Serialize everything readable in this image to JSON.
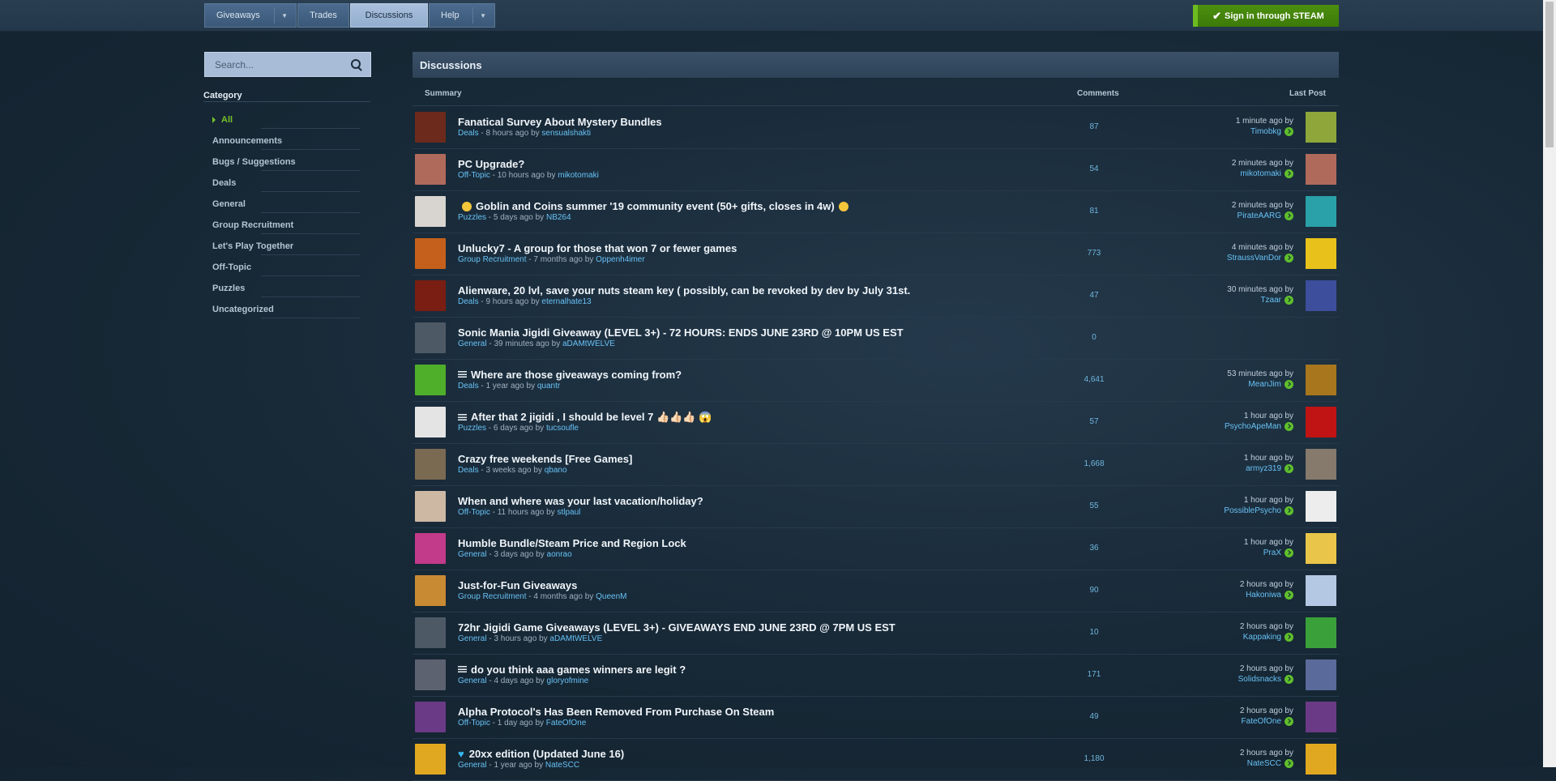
{
  "nav": {
    "giveaways": "Giveaways",
    "trades": "Trades",
    "discussions": "Discussions",
    "help": "Help",
    "signin": "Sign in through STEAM"
  },
  "search": {
    "placeholder": "Search..."
  },
  "sidebar": {
    "category_title": "Category",
    "items": [
      {
        "label": "All",
        "active": true
      },
      {
        "label": "Announcements"
      },
      {
        "label": "Bugs / Suggestions"
      },
      {
        "label": "Deals"
      },
      {
        "label": "General"
      },
      {
        "label": "Group Recruitment"
      },
      {
        "label": "Let's Play Together"
      },
      {
        "label": "Off-Topic"
      },
      {
        "label": "Puzzles"
      },
      {
        "label": "Uncategorized"
      }
    ]
  },
  "main": {
    "heading": "Discussions",
    "col_summary": "Summary",
    "col_comments": "Comments",
    "col_last_post": "Last Post",
    "rows": [
      {
        "title": "Fanatical Survey About Mystery Bundles",
        "category": "Deals",
        "age": "8 hours ago",
        "author": "sensualshakti",
        "comments": "87",
        "lp_time": "1 minute ago by",
        "lp_user": "Timobkg",
        "av_color": "#6b2a1c",
        "lp_color": "#8ea63a"
      },
      {
        "title": "PC Upgrade?",
        "category": "Off-Topic",
        "age": "10 hours ago",
        "author": "mikotomaki",
        "comments": "54",
        "lp_time": "2 minutes ago by",
        "lp_user": "mikotomaki",
        "av_color": "#b06a5c",
        "lp_color": "#b06a5c"
      },
      {
        "title": "Goblin and Coins summer '19 community event (50+ gifts, closes in 4w)",
        "emoji": true,
        "category": "Puzzles",
        "age": "5 days ago",
        "author": "NB264",
        "comments": "81",
        "lp_time": "2 minutes ago by",
        "lp_user": "PirateAARG",
        "av_color": "#d8d4d0",
        "lp_color": "#2aa0a8"
      },
      {
        "title": "Unlucky7 - A group for those that won 7 or fewer games",
        "category": "Group Recruitment",
        "age": "7 months ago",
        "author": "Oppenh4imer",
        "comments": "773",
        "lp_time": "4 minutes ago by",
        "lp_user": "StraussVanDor",
        "av_color": "#c4601c",
        "lp_color": "#e8c21a"
      },
      {
        "title": "Alienware, 20 lvl, save your nuts steam key ( possibly, can be revoked by dev by July 31st.",
        "category": "Deals",
        "age": "9 hours ago",
        "author": "eternalhate13",
        "comments": "47",
        "lp_time": "30 minutes ago by",
        "lp_user": "Tzaar",
        "av_color": "#7a1d12",
        "lp_color": "#3d4e9c"
      },
      {
        "title": "Sonic Mania Jigidi Giveaway (LEVEL 3+) - 72 HOURS: ENDS JUNE 23RD @ 10PM US EST",
        "category": "General",
        "age": "39 minutes ago",
        "author": "aDAMtWELVE",
        "comments": "0",
        "lp_time": "",
        "lp_user": "",
        "av_color": "#4e5966",
        "lp_color": ""
      },
      {
        "title": "Where are those giveaways coming from?",
        "poll": true,
        "category": "Deals",
        "age": "1 year ago",
        "author": "quantr",
        "comments": "4,641",
        "lp_time": "53 minutes ago by",
        "lp_user": "MeanJim",
        "av_color": "#4fae2a",
        "lp_color": "#a8761c"
      },
      {
        "title": "After that 2 jigidi , I should be level 7 👍🏻👍🏻👍🏻 😱",
        "poll": true,
        "category": "Puzzles",
        "age": "6 days ago",
        "author": "tucsoufle",
        "comments": "57",
        "lp_time": "1 hour ago by",
        "lp_user": "PsychoApeMan",
        "av_color": "#e4e4e4",
        "lp_color": "#c01414"
      },
      {
        "title": "Crazy free weekends [Free Games]",
        "category": "Deals",
        "age": "3 weeks ago",
        "author": "qbano",
        "comments": "1,668",
        "lp_time": "1 hour ago by",
        "lp_user": "armyz319",
        "av_color": "#7a6a52",
        "lp_color": "#867a6c"
      },
      {
        "title": "When and where was your last vacation/holiday?",
        "category": "Off-Topic",
        "age": "11 hours ago",
        "author": "stlpaul",
        "comments": "55",
        "lp_time": "1 hour ago by",
        "lp_user": "PossiblePsycho",
        "av_color": "#cdb8a4",
        "lp_color": "#ededed"
      },
      {
        "title": "Humble Bundle/Steam Price and Region Lock",
        "category": "General",
        "age": "3 days ago",
        "author": "aonrao",
        "comments": "36",
        "lp_time": "1 hour ago by",
        "lp_user": "PraX",
        "av_color": "#c23a8a",
        "lp_color": "#e9c54a"
      },
      {
        "title": "Just-for-Fun Giveaways",
        "category": "Group Recruitment",
        "age": "4 months ago",
        "author": "QueenM",
        "comments": "90",
        "lp_time": "2 hours ago by",
        "lp_user": "Hakoniwa",
        "av_color": "#c88a32",
        "lp_color": "#b4c8e4"
      },
      {
        "title": "72hr Jigidi Game Giveaways (LEVEL 3+) - GIVEAWAYS END JUNE 23RD @ 7PM US EST",
        "category": "General",
        "age": "3 hours ago",
        "author": "aDAMtWELVE",
        "comments": "10",
        "lp_time": "2 hours ago by",
        "lp_user": "Kappaking",
        "av_color": "#4e5966",
        "lp_color": "#3aa03a"
      },
      {
        "title": "do you think aaa games winners are legit ?",
        "poll": true,
        "category": "General",
        "age": "4 days ago",
        "author": "gloryofmine",
        "comments": "171",
        "lp_time": "2 hours ago by",
        "lp_user": "Solidsnacks",
        "av_color": "#5d6270",
        "lp_color": "#5a6a9a"
      },
      {
        "title": "Alpha Protocol's Has Been Removed From Purchase On Steam",
        "category": "Off-Topic",
        "age": "1 day ago",
        "author": "FateOfOne",
        "comments": "49",
        "lp_time": "2 hours ago by",
        "lp_user": "FateOfOne",
        "av_color": "#6a3a86",
        "lp_color": "#6a3a86"
      },
      {
        "title": "20xx edition (Updated June 16)",
        "heart": true,
        "category": "General",
        "age": "1 year ago",
        "author": "NateSCC",
        "comments": "1,180",
        "lp_time": "2 hours ago by",
        "lp_user": "NateSCC",
        "av_color": "#e0a820",
        "lp_color": "#e0a820"
      }
    ]
  }
}
